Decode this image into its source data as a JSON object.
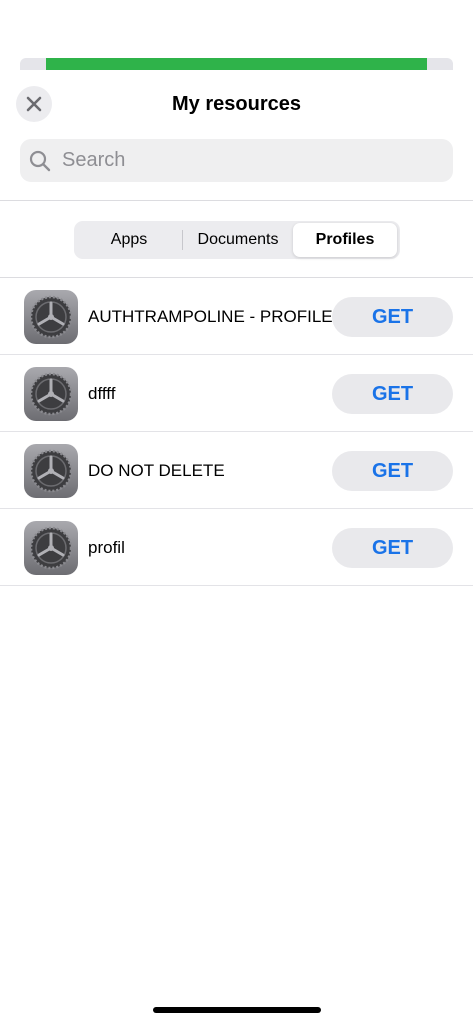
{
  "progress": {
    "value_fraction": 0.94,
    "color": "#2fb34a"
  },
  "header": {
    "title": "My resources",
    "close_icon": "close-icon"
  },
  "search": {
    "placeholder": "Search",
    "value": ""
  },
  "tabs": [
    {
      "label": "Apps",
      "active": false
    },
    {
      "label": "Documents",
      "active": false
    },
    {
      "label": "Profiles",
      "active": true
    }
  ],
  "profiles": [
    {
      "name": "AUTHTRAMPOLINE - PROFILE",
      "icon": "settings-gear-icon",
      "action": "GET"
    },
    {
      "name": "dffff",
      "icon": "settings-gear-icon",
      "action": "GET"
    },
    {
      "name": "DO NOT DELETE",
      "icon": "settings-gear-icon",
      "action": "GET"
    },
    {
      "name": "profil",
      "icon": "settings-gear-icon",
      "action": "GET"
    }
  ],
  "colors": {
    "accent": "#1a73e8",
    "button_bg": "#e9e9ec"
  }
}
